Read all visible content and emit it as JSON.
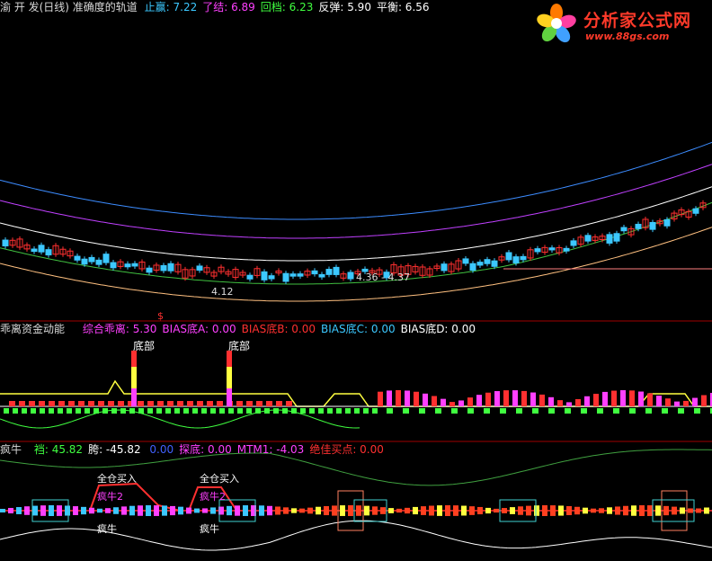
{
  "colors": {
    "background": "#000000",
    "title_white": "#d8d8d8",
    "cyan": "#3cc8ff",
    "magenta": "#ff40ff",
    "green": "#40ff40",
    "yellow": "#ffff40",
    "red": "#ff3030",
    "pink": "#ff60a0",
    "blue": "#4060ff",
    "separator": "#a00000",
    "logo_red": "#ff3a2a"
  },
  "logo": {
    "title": "分析家公式网",
    "url": "www.88gs.com",
    "icon": "flower-logo-icon"
  },
  "panel1": {
    "title": "渝 开 发(日线) 准确度的轨道",
    "indicators": [
      {
        "label": "止赢:",
        "value": "7.22",
        "color": "#3cc8ff"
      },
      {
        "label": "了结:",
        "value": "6.89",
        "color": "#ff40ff"
      },
      {
        "label": "回档:",
        "value": "6.23",
        "color": "#40ff40"
      },
      {
        "label": "反弹:",
        "value": "5.90",
        "color": "#ffffff"
      },
      {
        "label": "平衡:",
        "value": "6.56",
        "color": "#ffffff"
      }
    ],
    "annotations": {
      "low_price": "4.12",
      "range_label": "4.36 - 4.37",
      "signal_mark": "$"
    }
  },
  "panel2": {
    "title": "乖离资金动能",
    "indicators": [
      {
        "label": "综合乖离:",
        "value": "5.30",
        "color": "#ff40ff"
      },
      {
        "label": "BIAS底A:",
        "value": "0.00",
        "color": "#ff40ff"
      },
      {
        "label": "BIAS底B:",
        "value": "0.00",
        "color": "#ff3030"
      },
      {
        "label": "BIAS底C:",
        "value": "0.00",
        "color": "#3cc8ff"
      },
      {
        "label": "BIAS底D:",
        "value": "0.00",
        "color": "#ffffff"
      }
    ],
    "annotations": [
      "底部",
      "底部"
    ]
  },
  "panel3": {
    "title": "疯牛",
    "indicators": [
      {
        "label": "裆:",
        "value": "45.82",
        "color": "#40ff40"
      },
      {
        "label": "胯:",
        "value": "-45.82",
        "color": "#ffffff"
      },
      {
        "label": "",
        "value": "0.00",
        "color": "#4060ff"
      },
      {
        "label": "探底:",
        "value": "0.00",
        "color": "#ff40ff"
      },
      {
        "label": "MTM1:",
        "value": "-4.03",
        "color": "#ff40ff"
      },
      {
        "label": "绝佳买点:",
        "value": "0.00",
        "color": "#ff3030"
      }
    ],
    "annotations": {
      "buy_all_1": "全仓买入",
      "buy_all_2": "全仓买入",
      "crazy_bull_2a": "疯牛2",
      "crazy_bull_2b": "疯牛2",
      "crazy_bull_a": "疯牛",
      "crazy_bull_b": "疯牛"
    }
  }
}
